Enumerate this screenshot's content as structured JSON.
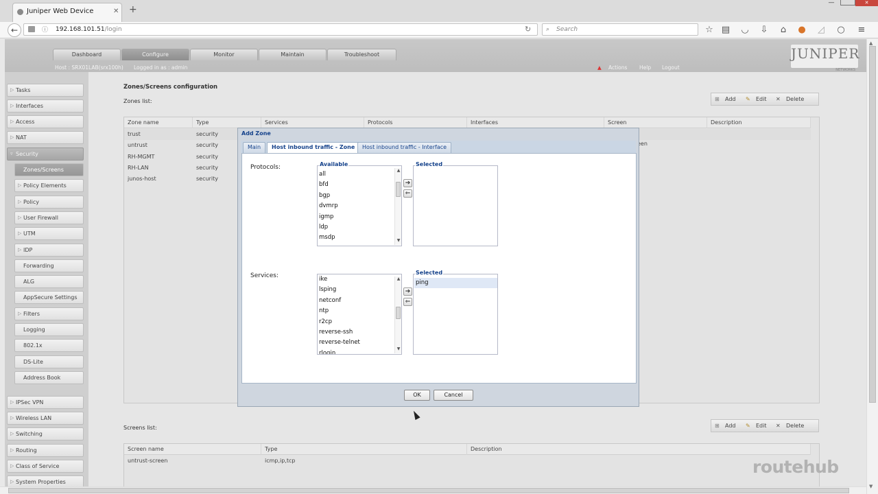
{
  "browser": {
    "tab_title": "Juniper Web Device Manag...",
    "new_tab": "+",
    "url_host": "192.168.101.51",
    "url_path": "/login",
    "search_placeholder": "Search"
  },
  "header": {
    "tabs": [
      "Dashboard",
      "Configure",
      "Monitor",
      "Maintain",
      "Troubleshoot"
    ],
    "active_tab": "Configure",
    "host_info": "Host : SRX01LAB(srx100h)",
    "logged_in": "Logged in as : admin",
    "links": [
      "Actions",
      "Help",
      "Logout"
    ],
    "logo": "JUNIPER",
    "logo_sub": "NETWORKS"
  },
  "sidebar": {
    "items_top": [
      "Tasks",
      "Interfaces",
      "Access",
      "NAT"
    ],
    "security": "Security",
    "security_items": [
      "Zones/Screens",
      "Policy Elements",
      "Policy",
      "User Firewall",
      "UTM",
      "IDP",
      "Forwarding",
      "ALG",
      "AppSecure Settings",
      "Filters",
      "Logging",
      "802.1x",
      "DS-Lite",
      "Address Book"
    ],
    "security_items_expandable": [
      "Policy Elements",
      "Policy",
      "User Firewall",
      "UTM",
      "IDP",
      "Filters"
    ],
    "items_bottom": [
      "IPSec VPN",
      "Wireless LAN",
      "Switching",
      "Routing",
      "Class of Service",
      "System Properties"
    ]
  },
  "content": {
    "page_title": "Zones/Screens configuration",
    "zones_label": "Zones list:",
    "screens_label": "Screens list:",
    "toolbar": {
      "add": "Add",
      "edit": "Edit",
      "delete": "Delete"
    },
    "zones_columns": [
      "Zone name",
      "Type",
      "Services",
      "Protocols",
      "Interfaces",
      "Screen",
      "Description"
    ],
    "zones_rows": [
      [
        "trust",
        "security"
      ],
      [
        "untrust",
        "security"
      ],
      [
        "RH-MGMT",
        "security"
      ],
      [
        "RH-LAN",
        "security"
      ],
      [
        "junos-host",
        "security"
      ]
    ],
    "zones_partial_screen_cell": "een",
    "screens_columns": [
      "Screen name",
      "Type",
      "Description"
    ],
    "screens_rows": [
      [
        "untrust-screen",
        "icmp,ip,tcp",
        ""
      ]
    ]
  },
  "modal": {
    "title": "Add Zone",
    "tabs": [
      "Main",
      "Host inbound traffic - Zone",
      "Host inbound traffic - Interface"
    ],
    "active_tab": "Host inbound traffic - Zone",
    "protocols_label": "Protocols:",
    "services_label": "Services:",
    "available_label": "Available",
    "selected_label": "Selected",
    "protocols_available": [
      "all",
      "bfd",
      "bgp",
      "dvmrp",
      "igmp",
      "ldp",
      "msdp"
    ],
    "protocols_selected": [],
    "services_available": [
      "ike",
      "lsping",
      "netconf",
      "ntp",
      "r2cp",
      "reverse-ssh",
      "reverse-telnet",
      "rlogin"
    ],
    "services_selected": [
      "ping"
    ],
    "move_right": "➔",
    "move_left": "⇐",
    "ok": "OK",
    "cancel": "Cancel"
  },
  "watermark": "routehub"
}
